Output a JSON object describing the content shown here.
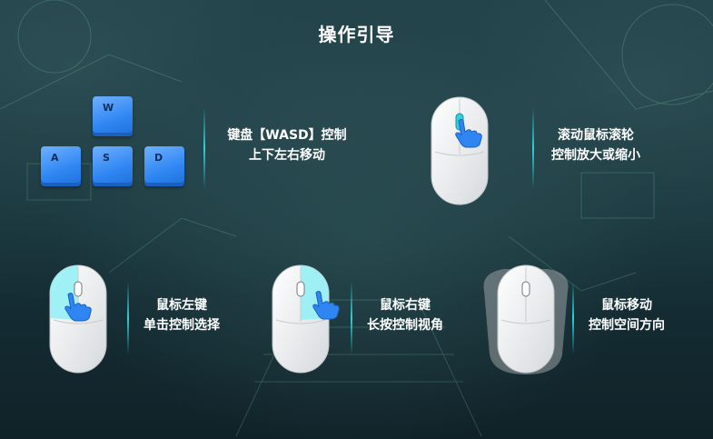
{
  "title": "操作引导",
  "keys": [
    "W",
    "A",
    "S",
    "D"
  ],
  "guides": {
    "keyboard": {
      "line1": "键盘【WASD】控制",
      "line2": "上下左右移动"
    },
    "scroll": {
      "line1": "滚动鼠标滚轮",
      "line2": "控制放大或缩小"
    },
    "left_click": {
      "line1": "鼠标左键",
      "line2": "单击控制选择"
    },
    "right_click": {
      "line1": "鼠标右键",
      "line2": "长按控制视角"
    },
    "move": {
      "line1": "鼠标移动",
      "line2": "控制空间方向"
    }
  },
  "colors": {
    "accent": "#2fd0da",
    "key_blue": "#2f86f2",
    "highlight": "#8ff0f5",
    "hand": "#2f86f2"
  }
}
